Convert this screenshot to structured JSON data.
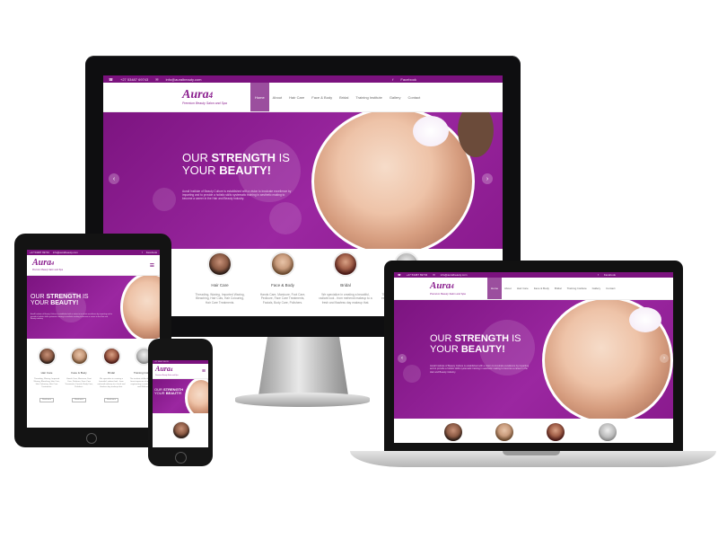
{
  "site": {
    "phone": "+27 53487 69743",
    "email": "info@auralbeauty.com",
    "facebook": "Facebook",
    "logo": "Aura",
    "tagline": "Premium Beauty Salon and Spa",
    "headline_pre": "OUR",
    "headline_strong": "STRENGTH",
    "headline_mid": "IS",
    "headline_pre2": "YOUR",
    "headline_strong2": "BEAUTY!",
    "blurb": "Aurall Institute of Beauty Culture is established with a vision to inculcate excellence by imparting and to provide a holistic skills systematic training in aesthetic making to become a career in the Hair and Beauty industry.",
    "nav": [
      "Home",
      "About",
      "Hair Care",
      "Face & Body",
      "Bridal",
      "Training Institute",
      "Gallery",
      "Contact"
    ],
    "services": [
      {
        "title": "Hair Care",
        "desc": "Threading, Waxing, Imported Waxing, Bleaching, Hair Cuts, Hair Colouring, Hair Care Treatments."
      },
      {
        "title": "Face & Body",
        "desc": "Hands Care, Manicure, Foot Care, Pedicure, Face Care Treatments, Facials, Body Care, Polishers."
      },
      {
        "title": "Bridal",
        "desc": "We specialize in creating a beautiful, radiant look - from mehendi makeup to a fresh and flawless day makeup that."
      },
      {
        "title": "Training Institute",
        "desc": "The institute of Aesthetics is the finest exposure of making and engineering a creative Beauty and Wellness."
      }
    ],
    "read_more": "Read more"
  },
  "colors": {
    "brand": "#7b127e",
    "hero": "#9b27a1",
    "active_nav": "#9b4f9e"
  },
  "icons": [
    "phone-icon",
    "mail-icon",
    "facebook-icon",
    "prev-arrow-icon",
    "next-arrow-icon",
    "hamburger-menu-icon"
  ]
}
